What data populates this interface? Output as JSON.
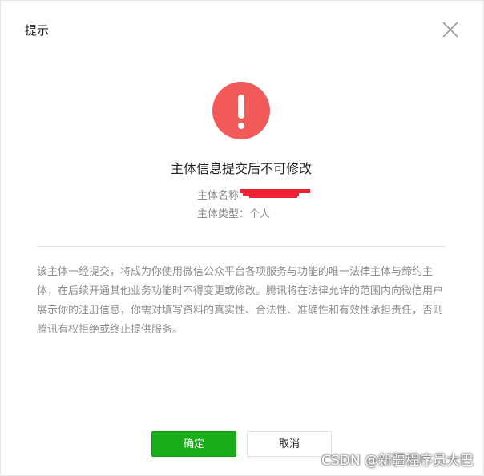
{
  "dialog": {
    "title": "提示",
    "heading": "主体信息提交后不可修改",
    "subject_name_label": "主体名称",
    "subject_type": "主体类型：个人",
    "description": "该主体一经提交，将成为你使用微信公众平台各项服务与功能的唯一法律主体与缔约主体，在后续开通其他业务功能时不得变更或修改。腾讯将在法律允许的范围内向微信用户展示你的注册信息，你需对填写资料的真实性、合法性、准确性和有效性承担责任，否则腾讯有权拒绝或终止提供服务。",
    "confirm_label": "确定",
    "cancel_label": "取消"
  },
  "icons": {
    "close": "close-icon",
    "alert": "exclamation-alert-icon"
  },
  "colors": {
    "alert": "#f25a5a",
    "confirm_button": "#1aad19",
    "redaction": "#ee2233"
  },
  "watermark": "CSDN @新疆程序员大巴"
}
